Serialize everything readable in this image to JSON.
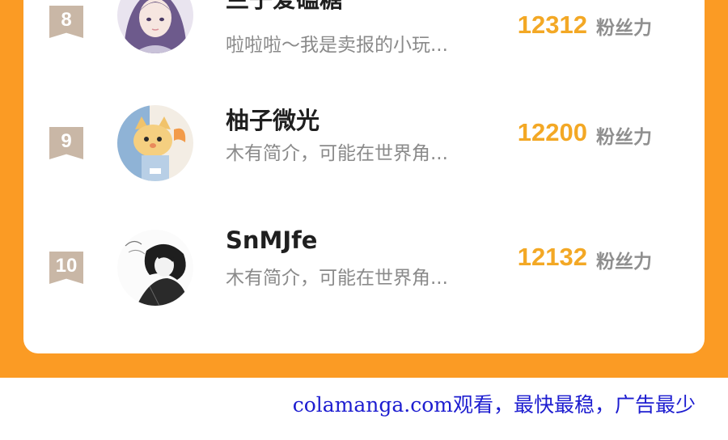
{
  "colors": {
    "background": "#fb9b24",
    "card": "#ffffff",
    "rank_badge": "#c9b7a6",
    "fan_count": "#f3a825",
    "watermark": "#1d1dd0"
  },
  "ranking": [
    {
      "rank": "8",
      "name": "兰子爱磕糖",
      "bio": "啦啦啦～我是卖报的小玩...",
      "fans": "12312",
      "unit": "粉丝力",
      "avatar_icon": "anime-girl-purple-hair-icon"
    },
    {
      "rank": "9",
      "name": "柚子微光",
      "bio": "木有简介，可能在世界角...",
      "fans": "12200",
      "unit": "粉丝力",
      "avatar_icon": "cartoon-fox-icon"
    },
    {
      "rank": "10",
      "name": "SnMJfe",
      "bio": "木有简介，可能在世界角...",
      "fans": "12132",
      "unit": "粉丝力",
      "avatar_icon": "sketch-figure-icon"
    }
  ],
  "watermark": "colamanga.com观看，最快最稳，广告最少"
}
